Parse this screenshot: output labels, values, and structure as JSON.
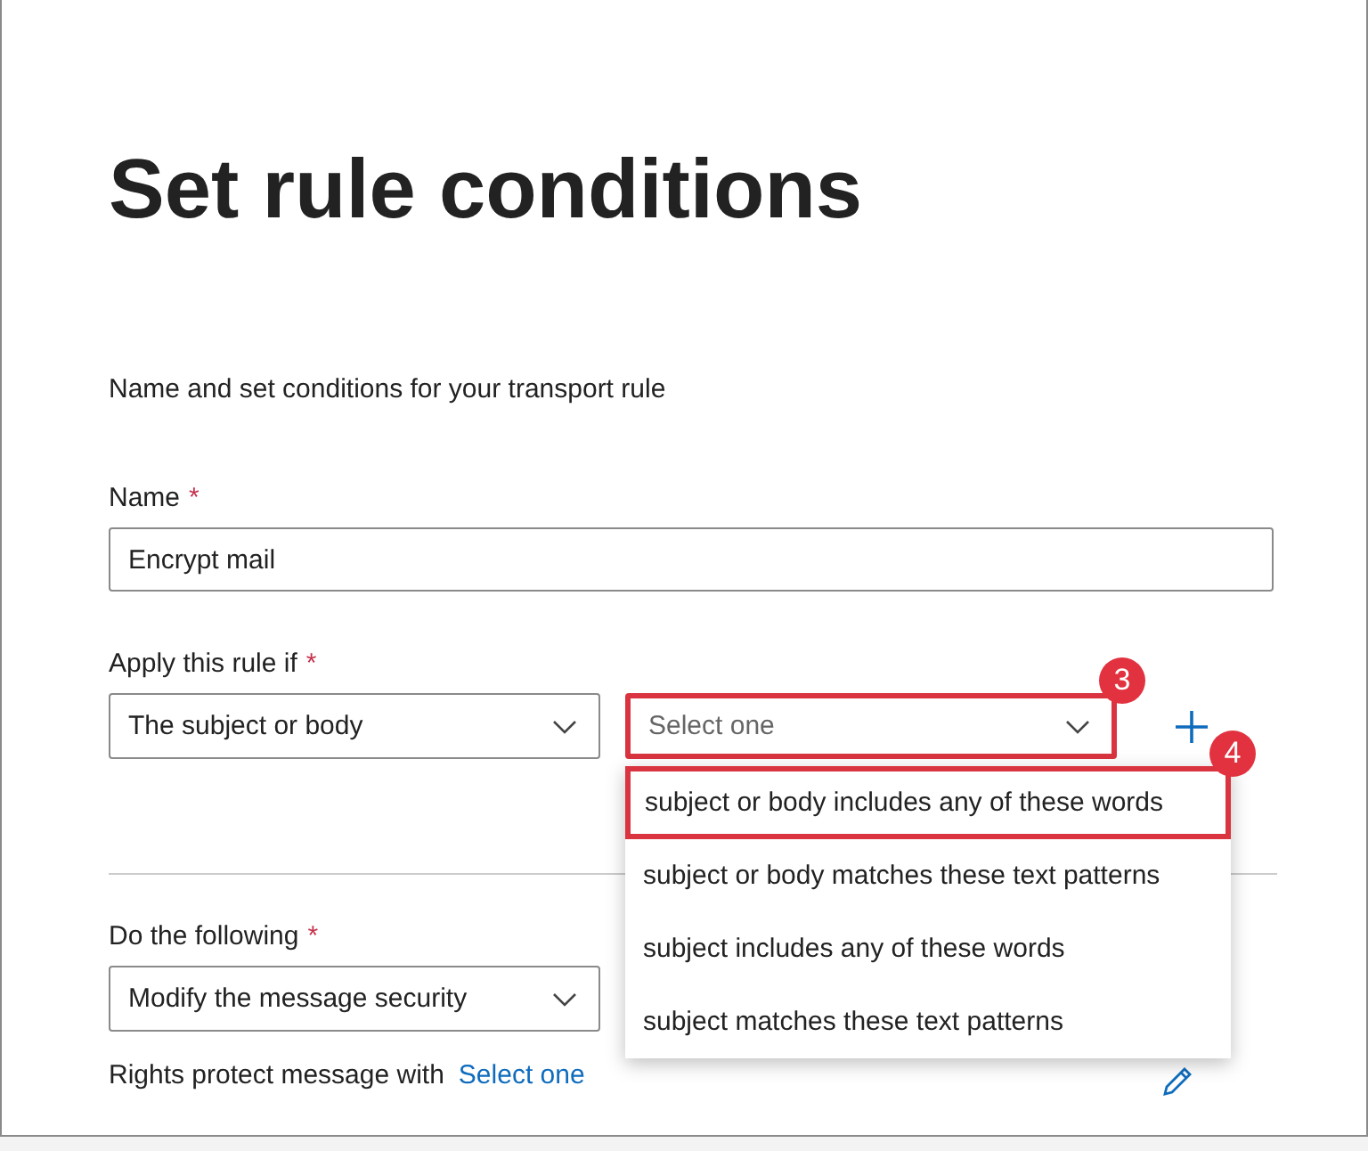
{
  "title": "Set rule conditions",
  "description": "Name and set conditions for your transport rule",
  "name_field": {
    "label": "Name",
    "required_mark": "*",
    "value": "Encrypt mail"
  },
  "condition": {
    "label": "Apply this rule if",
    "required_mark": "*",
    "first_select": {
      "value": "The subject or body"
    },
    "second_select": {
      "placeholder": "Select one",
      "highlighted": true,
      "callout": "3",
      "expanded": true
    },
    "options": [
      {
        "label": "subject or body includes any of these words",
        "highlighted": true,
        "callout": "4"
      },
      {
        "label": "subject or body matches these text patterns",
        "highlighted": false
      },
      {
        "label": "subject includes any of these words",
        "highlighted": false
      },
      {
        "label": "subject matches these text patterns",
        "highlighted": false
      }
    ]
  },
  "action": {
    "label": "Do the following",
    "required_mark": "*",
    "select": {
      "value": "Modify the message security"
    },
    "detail_label": "Rights protect message with",
    "detail_link": "Select one"
  }
}
